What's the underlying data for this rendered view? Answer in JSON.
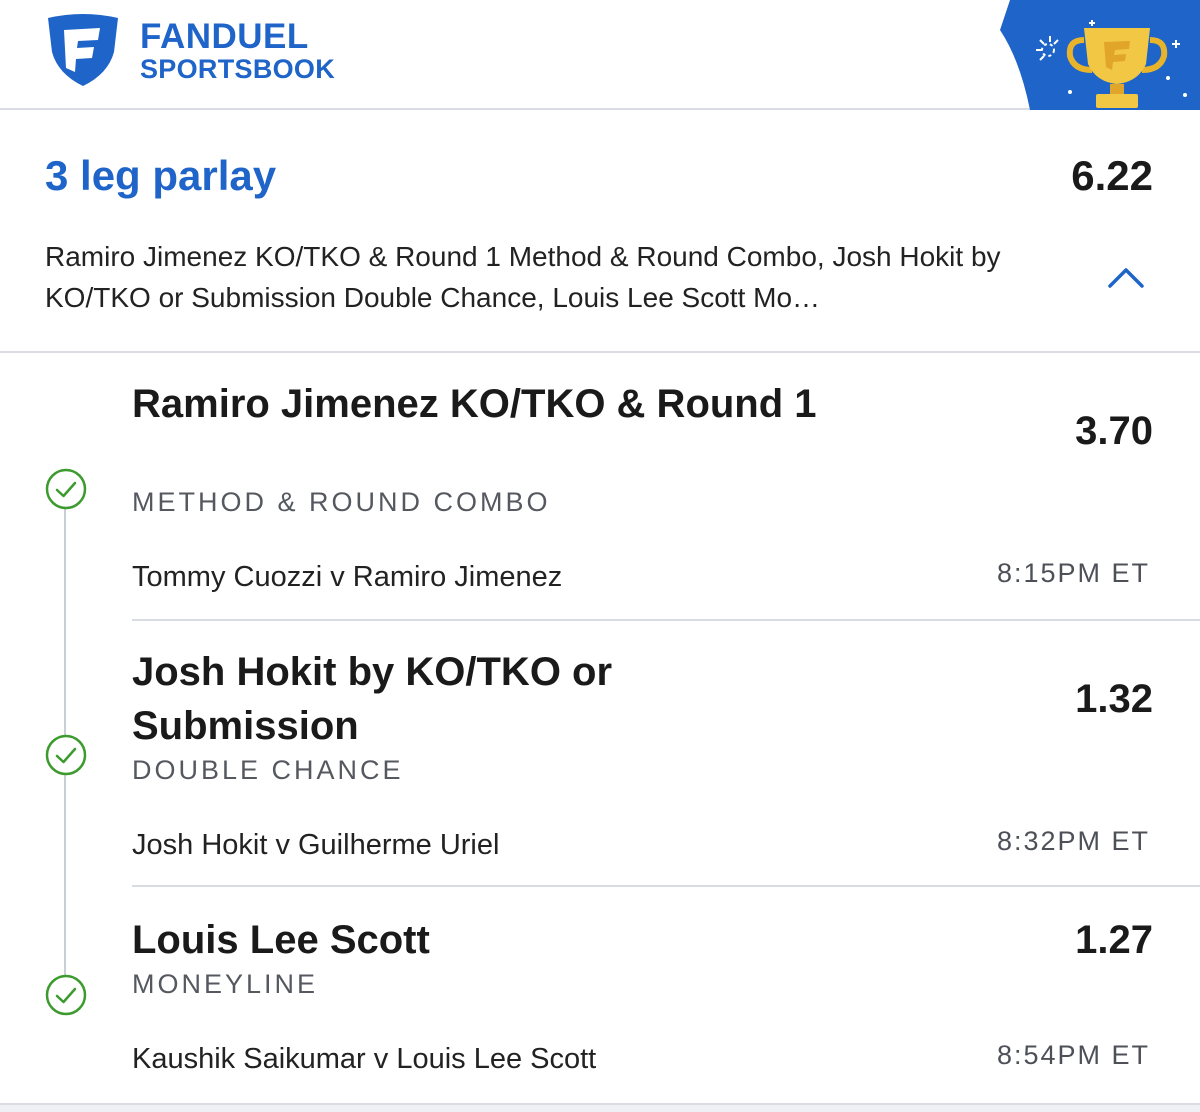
{
  "brand": {
    "name_line1": "FANDUEL",
    "name_line2": "SPORTSBOOK",
    "color": "#1f64c8",
    "logo_icon": "fanduel-shield-icon",
    "badge_icon": "trophy-icon"
  },
  "parlay": {
    "title": "3 leg parlay",
    "odds": "6.22",
    "description": "Ramiro Jimenez KO/TKO & Round 1 Method & Round Combo, Josh Hokit by KO/TKO or Submission Double Chance, Louis Lee Scott Mo…",
    "toggle_icon": "chevron-up-icon"
  },
  "legs": [
    {
      "title": "Ramiro Jimenez KO/TKO & Round 1",
      "market": "METHOD & ROUND COMBO",
      "odds": "3.70",
      "event": "Tommy Cuozzi v Ramiro Jimenez",
      "time": "8:15PM ET",
      "status_icon": "check-circle-icon"
    },
    {
      "title": "Josh Hokit by KO/TKO or Submission",
      "market": "DOUBLE CHANCE",
      "odds": "1.32",
      "event": "Josh Hokit v Guilherme Uriel",
      "time": "8:32PM ET",
      "status_icon": "check-circle-icon"
    },
    {
      "title": "Louis Lee Scott",
      "market": "MONEYLINE",
      "odds": "1.27",
      "event": "Kaushik Saikumar v Louis Lee Scott",
      "time": "8:54PM ET",
      "status_icon": "check-circle-icon"
    }
  ],
  "colors": {
    "win_green": "#3c9a2e",
    "divider": "#d9dde3"
  }
}
